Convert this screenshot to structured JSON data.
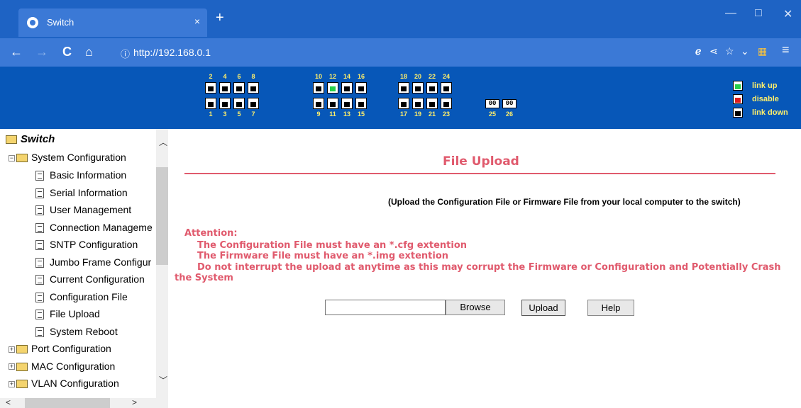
{
  "browser": {
    "tab_title": "Switch",
    "tab_close": "×",
    "new_tab": "+",
    "win_min": "—",
    "win_max": "□",
    "win_close": "✕",
    "back": "←",
    "forward": "→",
    "reload": "C",
    "home": "⌂",
    "url": "http://192.168.0.1",
    "info_icon": "ⓘ"
  },
  "switch_header": {
    "ports_top": [
      "2",
      "4",
      "6",
      "8",
      "10",
      "12",
      "14",
      "16",
      "18",
      "20",
      "22",
      "24"
    ],
    "ports_bottom": [
      "1",
      "3",
      "5",
      "7",
      "9",
      "11",
      "13",
      "15",
      "17",
      "19",
      "21",
      "23"
    ],
    "link_up_port": "12",
    "sfp_ports": [
      "25",
      "26"
    ],
    "sfp_glyph": "00",
    "legend": [
      {
        "label": "link up",
        "color": "#27d04a"
      },
      {
        "label": "disable",
        "color": "#e01b1b"
      },
      {
        "label": "link down",
        "color": "#000000"
      }
    ]
  },
  "sidebar": {
    "root": "Switch",
    "system_config": "System Configuration",
    "system_items": [
      "Basic Information",
      "Serial Information",
      "User Management",
      "Connection Manageme",
      "SNTP Configuration",
      "Jumbo Frame Configur",
      "Current Configuration",
      "Configuration File",
      "File Upload",
      "System Reboot"
    ],
    "other_folders": [
      "Port Configuration",
      "MAC Configuration",
      "VLAN Configuration"
    ]
  },
  "main": {
    "title": "File Upload",
    "subtitle": "(Upload the Configuration File or Firmware File from your local computer to the switch)",
    "attention_label": "Attention:",
    "attention_lines": [
      "The Configuration File must have an *.cfg extention",
      "The Firmware File must have an *.img extention",
      "Do not interrupt the upload at anytime as this may corrupt the Firmware or Configuration and Potentially Crash"
    ],
    "attention_tail": "the System",
    "browse_label": "Browse",
    "upload_label": "Upload",
    "help_label": "Help",
    "file_value": ""
  }
}
